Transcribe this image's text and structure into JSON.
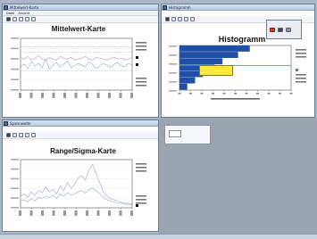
{
  "windows": {
    "mean_chart": {
      "title_bar": "Mittelwert-Karte",
      "menu": [
        "Datei",
        "Ansicht"
      ],
      "chart_title": "Mittelwert-Karte"
    },
    "histogram": {
      "title_bar": "Histogramm",
      "chart_title": "Histogramm",
      "tooltip_lines": [
        "",
        ""
      ]
    },
    "range_chart": {
      "title_bar": "Spannweite",
      "chart_title": "Range/Sigma-Karte"
    },
    "small_popup": {
      "text": ""
    }
  },
  "chart_data": [
    {
      "type": "line",
      "title": "Mittelwert-Karte",
      "series": [
        {
          "name": "",
          "values": [
            27,
            30,
            25,
            33,
            28,
            31,
            26,
            36,
            24,
            29,
            32,
            27,
            30,
            34,
            26,
            28,
            31,
            29,
            27,
            33,
            30,
            25,
            28,
            31,
            29,
            26,
            30,
            32,
            28,
            27,
            31,
            29
          ]
        },
        {
          "name": "",
          "values": [
            38,
            36,
            39,
            35,
            37,
            40,
            36,
            34,
            38,
            36,
            35,
            39,
            37,
            36,
            38,
            35,
            36,
            37,
            39,
            36,
            35,
            38,
            37,
            36,
            35,
            37,
            38,
            36,
            37,
            35,
            36,
            38
          ]
        }
      ],
      "limits": [
        22,
        44,
        50
      ]
    },
    {
      "type": "bar",
      "title": "Histogramm",
      "bins": [
        0.9,
        0.75,
        0.55,
        0.45,
        0.3,
        0.2,
        0.1
      ],
      "bar_color": "#1f4fa8"
    },
    {
      "type": "line",
      "title": "Range/Sigma-Karte",
      "series": [
        {
          "name": "",
          "values": [
            10,
            12,
            9,
            14,
            11,
            15,
            13,
            18,
            14,
            16,
            12,
            19,
            15,
            22,
            17,
            20,
            26,
            28,
            24,
            33,
            38,
            30,
            22,
            14,
            10,
            8,
            7,
            6,
            5,
            4,
            4,
            3
          ]
        },
        {
          "name": "",
          "values": [
            6,
            7,
            5,
            8,
            6,
            9,
            8,
            10,
            9,
            11,
            8,
            12,
            10,
            13,
            11,
            12,
            14,
            15,
            13,
            16,
            17,
            15,
            12,
            9,
            7,
            6,
            5,
            4,
            4,
            3,
            3,
            2
          ]
        }
      ]
    }
  ],
  "colors": {
    "desktop": "#a9b7c9",
    "bar": "#1f4fa8",
    "tooltip": "#ffe93a",
    "close": "#d63c2f"
  }
}
